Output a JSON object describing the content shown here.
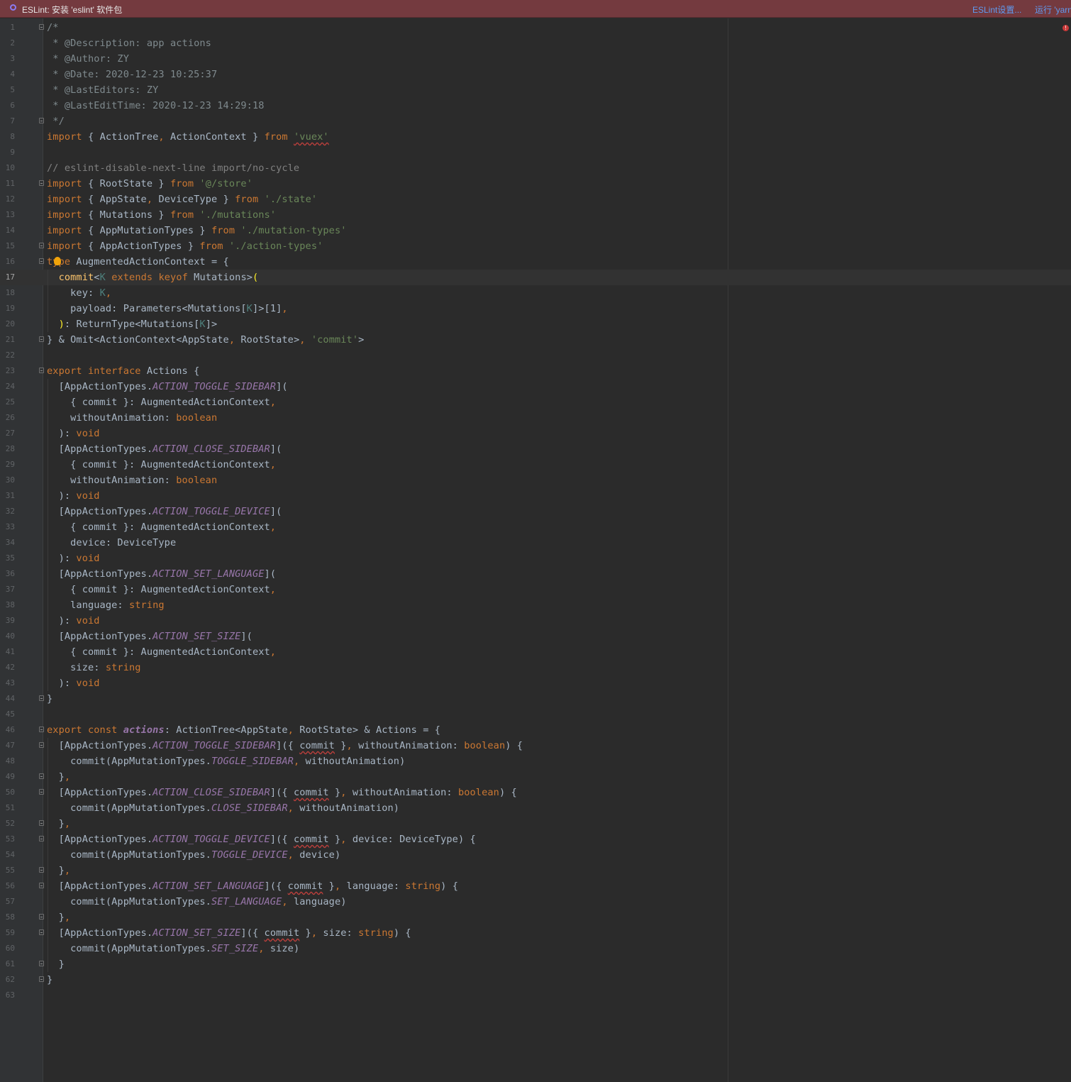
{
  "banner": {
    "title": "ESLint: 安装 'eslint' 软件包",
    "settings_link": "ESLint设置...",
    "run_link": "运行 'yarn"
  },
  "editor": {
    "current_line": 17,
    "colors": {
      "keyword": "#cc7832",
      "string": "#6a8759",
      "comment": "#808080",
      "property": "#9876aa",
      "type_param": "#4e807d",
      "function": "#ffc66d",
      "default": "#a9b7c6"
    },
    "lines": [
      [
        {
          "t": "/*",
          "c": "doc"
        }
      ],
      [
        {
          "t": " * @Description: app actions",
          "c": "doc"
        }
      ],
      [
        {
          "t": " * @Author: ZY",
          "c": "doc"
        }
      ],
      [
        {
          "t": " * @Date: 2020-12-23 10:25:37",
          "c": "doc"
        }
      ],
      [
        {
          "t": " * @LastEditors: ZY",
          "c": "doc"
        }
      ],
      [
        {
          "t": " * @LastEditTime: 2020-12-23 14:29:18",
          "c": "doc"
        }
      ],
      [
        {
          "t": " */",
          "c": "doc"
        }
      ],
      [
        {
          "t": "import",
          "c": "kw"
        },
        {
          "t": " { ActionTree"
        },
        {
          "t": ",",
          "c": "punc"
        },
        {
          "t": " ActionContext } "
        },
        {
          "t": "from",
          "c": "kw"
        },
        {
          "t": " "
        },
        {
          "t": "'vuex'",
          "c": "str err"
        }
      ],
      [],
      [
        {
          "t": "// eslint-disable-next-line import/no-cycle",
          "c": "com"
        }
      ],
      [
        {
          "t": "import",
          "c": "kw"
        },
        {
          "t": " { RootState } "
        },
        {
          "t": "from",
          "c": "kw"
        },
        {
          "t": " "
        },
        {
          "t": "'@/store'",
          "c": "str"
        }
      ],
      [
        {
          "t": "import",
          "c": "kw"
        },
        {
          "t": " { AppState"
        },
        {
          "t": ",",
          "c": "punc"
        },
        {
          "t": " DeviceType } "
        },
        {
          "t": "from",
          "c": "kw"
        },
        {
          "t": " "
        },
        {
          "t": "'./state'",
          "c": "str"
        }
      ],
      [
        {
          "t": "import",
          "c": "kw"
        },
        {
          "t": " { Mutations } "
        },
        {
          "t": "from",
          "c": "kw"
        },
        {
          "t": " "
        },
        {
          "t": "'./mutations'",
          "c": "str"
        }
      ],
      [
        {
          "t": "import",
          "c": "kw"
        },
        {
          "t": " { AppMutationTypes } "
        },
        {
          "t": "from",
          "c": "kw"
        },
        {
          "t": " "
        },
        {
          "t": "'./mutation-types'",
          "c": "str"
        }
      ],
      [
        {
          "t": "import",
          "c": "kw"
        },
        {
          "t": " { AppActionTypes } "
        },
        {
          "t": "from",
          "c": "kw"
        },
        {
          "t": " "
        },
        {
          "t": "'./action-types'",
          "c": "str"
        }
      ],
      [
        {
          "t": "type",
          "c": "kw"
        },
        {
          "t": " AugmentedActionContext = {"
        }
      ],
      [
        {
          "t": "  "
        },
        {
          "t": "commit",
          "c": "fn"
        },
        {
          "t": "<"
        },
        {
          "t": "K",
          "c": "tp"
        },
        {
          "t": " "
        },
        {
          "t": "extends keyof",
          "c": "kw"
        },
        {
          "t": " Mutations>"
        },
        {
          "t": "(",
          "c": "brace"
        }
      ],
      [
        {
          "t": "    key: "
        },
        {
          "t": "K",
          "c": "tp"
        },
        {
          "t": ",",
          "c": "punc"
        }
      ],
      [
        {
          "t": "    payload: Parameters<Mutations["
        },
        {
          "t": "K",
          "c": "tp"
        },
        {
          "t": "]>[1]"
        },
        {
          "t": ",",
          "c": "punc"
        }
      ],
      [
        {
          "t": "  "
        },
        {
          "t": ")",
          "c": "brace"
        },
        {
          "t": ": ReturnType<Mutations["
        },
        {
          "t": "K",
          "c": "tp"
        },
        {
          "t": "]>"
        }
      ],
      [
        {
          "t": "} & Omit<ActionContext<AppState"
        },
        {
          "t": ",",
          "c": "punc"
        },
        {
          "t": " RootState>"
        },
        {
          "t": ",",
          "c": "punc"
        },
        {
          "t": " "
        },
        {
          "t": "'commit'",
          "c": "str"
        },
        {
          "t": ">"
        }
      ],
      [],
      [
        {
          "t": "export interface",
          "c": "kw"
        },
        {
          "t": " Actions {"
        }
      ],
      [
        {
          "t": "  [AppActionTypes."
        },
        {
          "t": "ACTION_TOGGLE_SIDEBAR",
          "c": "prop"
        },
        {
          "t": "]("
        }
      ],
      [
        {
          "t": "    { commit }: AugmentedActionContext"
        },
        {
          "t": ",",
          "c": "punc"
        }
      ],
      [
        {
          "t": "    withoutAnimation: "
        },
        {
          "t": "boolean",
          "c": "kw"
        }
      ],
      [
        {
          "t": "  ): "
        },
        {
          "t": "void",
          "c": "kw"
        }
      ],
      [
        {
          "t": "  [AppActionTypes."
        },
        {
          "t": "ACTION_CLOSE_SIDEBAR",
          "c": "prop"
        },
        {
          "t": "]("
        }
      ],
      [
        {
          "t": "    { commit }: AugmentedActionContext"
        },
        {
          "t": ",",
          "c": "punc"
        }
      ],
      [
        {
          "t": "    withoutAnimation: "
        },
        {
          "t": "boolean",
          "c": "kw"
        }
      ],
      [
        {
          "t": "  ): "
        },
        {
          "t": "void",
          "c": "kw"
        }
      ],
      [
        {
          "t": "  [AppActionTypes."
        },
        {
          "t": "ACTION_TOGGLE_DEVICE",
          "c": "prop"
        },
        {
          "t": "]("
        }
      ],
      [
        {
          "t": "    { commit }: AugmentedActionContext"
        },
        {
          "t": ",",
          "c": "punc"
        }
      ],
      [
        {
          "t": "    device: DeviceType"
        }
      ],
      [
        {
          "t": "  ): "
        },
        {
          "t": "void",
          "c": "kw"
        }
      ],
      [
        {
          "t": "  [AppActionTypes."
        },
        {
          "t": "ACTION_SET_LANGUAGE",
          "c": "prop"
        },
        {
          "t": "]("
        }
      ],
      [
        {
          "t": "    { commit }: AugmentedActionContext"
        },
        {
          "t": ",",
          "c": "punc"
        }
      ],
      [
        {
          "t": "    language: "
        },
        {
          "t": "string",
          "c": "kw"
        }
      ],
      [
        {
          "t": "  ): "
        },
        {
          "t": "void",
          "c": "kw"
        }
      ],
      [
        {
          "t": "  [AppActionTypes."
        },
        {
          "t": "ACTION_SET_SIZE",
          "c": "prop"
        },
        {
          "t": "]("
        }
      ],
      [
        {
          "t": "    { commit }: AugmentedActionContext"
        },
        {
          "t": ",",
          "c": "punc"
        }
      ],
      [
        {
          "t": "    size: "
        },
        {
          "t": "string",
          "c": "kw"
        }
      ],
      [
        {
          "t": "  ): "
        },
        {
          "t": "void",
          "c": "kw"
        }
      ],
      [
        {
          "t": "}"
        }
      ],
      [],
      [
        {
          "t": "export const",
          "c": "kw"
        },
        {
          "t": " "
        },
        {
          "t": "actions",
          "c": "fnb"
        },
        {
          "t": ": ActionTree<AppState"
        },
        {
          "t": ",",
          "c": "punc"
        },
        {
          "t": " RootState> & Actions = {"
        }
      ],
      [
        {
          "t": "  [AppActionTypes."
        },
        {
          "t": "ACTION_TOGGLE_SIDEBAR",
          "c": "prop"
        },
        {
          "t": "]({ "
        },
        {
          "t": "commit",
          "c": "err"
        },
        {
          "t": " }"
        },
        {
          "t": ",",
          "c": "punc"
        },
        {
          "t": " withoutAnimation: "
        },
        {
          "t": "boolean",
          "c": "kw"
        },
        {
          "t": ") {"
        }
      ],
      [
        {
          "t": "    commit(AppMutationTypes."
        },
        {
          "t": "TOGGLE_SIDEBAR",
          "c": "prop"
        },
        {
          "t": ",",
          "c": "punc"
        },
        {
          "t": " withoutAnimation)"
        }
      ],
      [
        {
          "t": "  }"
        },
        {
          "t": ",",
          "c": "punc"
        }
      ],
      [
        {
          "t": "  [AppActionTypes."
        },
        {
          "t": "ACTION_CLOSE_SIDEBAR",
          "c": "prop"
        },
        {
          "t": "]({ "
        },
        {
          "t": "commit",
          "c": "err"
        },
        {
          "t": " }"
        },
        {
          "t": ",",
          "c": "punc"
        },
        {
          "t": " withoutAnimation: "
        },
        {
          "t": "boolean",
          "c": "kw"
        },
        {
          "t": ") {"
        }
      ],
      [
        {
          "t": "    commit(AppMutationTypes."
        },
        {
          "t": "CLOSE_SIDEBAR",
          "c": "prop"
        },
        {
          "t": ",",
          "c": "punc"
        },
        {
          "t": " withoutAnimation)"
        }
      ],
      [
        {
          "t": "  }"
        },
        {
          "t": ",",
          "c": "punc"
        }
      ],
      [
        {
          "t": "  [AppActionTypes."
        },
        {
          "t": "ACTION_TOGGLE_DEVICE",
          "c": "prop"
        },
        {
          "t": "]({ "
        },
        {
          "t": "commit",
          "c": "err"
        },
        {
          "t": " }"
        },
        {
          "t": ",",
          "c": "punc"
        },
        {
          "t": " device: DeviceType) {"
        }
      ],
      [
        {
          "t": "    commit(AppMutationTypes."
        },
        {
          "t": "TOGGLE_DEVICE",
          "c": "prop"
        },
        {
          "t": ",",
          "c": "punc"
        },
        {
          "t": " device)"
        }
      ],
      [
        {
          "t": "  }"
        },
        {
          "t": ",",
          "c": "punc"
        }
      ],
      [
        {
          "t": "  [AppActionTypes."
        },
        {
          "t": "ACTION_SET_LANGUAGE",
          "c": "prop"
        },
        {
          "t": "]({ "
        },
        {
          "t": "commit",
          "c": "err"
        },
        {
          "t": " }"
        },
        {
          "t": ",",
          "c": "punc"
        },
        {
          "t": " language: "
        },
        {
          "t": "string",
          "c": "kw"
        },
        {
          "t": ") {"
        }
      ],
      [
        {
          "t": "    commit(AppMutationTypes."
        },
        {
          "t": "SET_LANGUAGE",
          "c": "prop"
        },
        {
          "t": ",",
          "c": "punc"
        },
        {
          "t": " language)"
        }
      ],
      [
        {
          "t": "  }"
        },
        {
          "t": ",",
          "c": "punc"
        }
      ],
      [
        {
          "t": "  [AppActionTypes."
        },
        {
          "t": "ACTION_SET_SIZE",
          "c": "prop"
        },
        {
          "t": "]({ "
        },
        {
          "t": "commit",
          "c": "err"
        },
        {
          "t": " }"
        },
        {
          "t": ",",
          "c": "punc"
        },
        {
          "t": " size: "
        },
        {
          "t": "string",
          "c": "kw"
        },
        {
          "t": ") {"
        }
      ],
      [
        {
          "t": "    commit(AppMutationTypes."
        },
        {
          "t": "SET_SIZE",
          "c": "prop"
        },
        {
          "t": ",",
          "c": "punc"
        },
        {
          "t": " size)"
        }
      ],
      [
        {
          "t": "  }"
        }
      ],
      [
        {
          "t": "}"
        }
      ],
      []
    ],
    "fold_lines": [
      1,
      7,
      11,
      15,
      16,
      21,
      23,
      44,
      46,
      47,
      49,
      50,
      52,
      53,
      55,
      56,
      58,
      59,
      61,
      62
    ],
    "bulb_line": 16,
    "error_marker": "!"
  }
}
